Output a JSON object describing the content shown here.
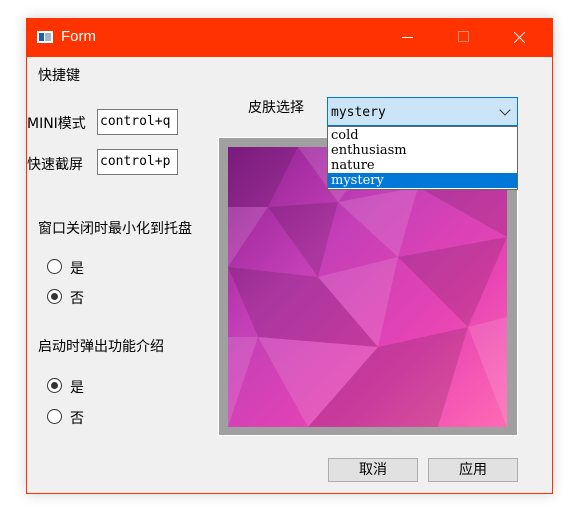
{
  "window": {
    "title": "Form",
    "accent_color": "#ff3300"
  },
  "shortcuts": {
    "section_label": "快捷键",
    "mini_mode": {
      "label": "MINI模式",
      "value": "control+q"
    },
    "screenshot": {
      "label": "快速截屏",
      "value": "control+p"
    }
  },
  "minimize_to_tray": {
    "label": "窗口关闭时最小化到托盘",
    "options": [
      {
        "label": "是",
        "checked": false
      },
      {
        "label": "否",
        "checked": true
      }
    ]
  },
  "startup_intro": {
    "label": "启动时弹出功能介绍",
    "options": [
      {
        "label": "是",
        "checked": true
      },
      {
        "label": "否",
        "checked": false
      }
    ]
  },
  "skin": {
    "label": "皮肤选择",
    "selected": "mystery",
    "options": [
      "cold",
      "enthusiasm",
      "nature",
      "mystery"
    ],
    "preview_colors": [
      "#8c1f8f",
      "#c43fb7",
      "#e844b4",
      "#ff6ab4"
    ]
  },
  "buttons": {
    "cancel": "取消",
    "apply": "应用"
  }
}
